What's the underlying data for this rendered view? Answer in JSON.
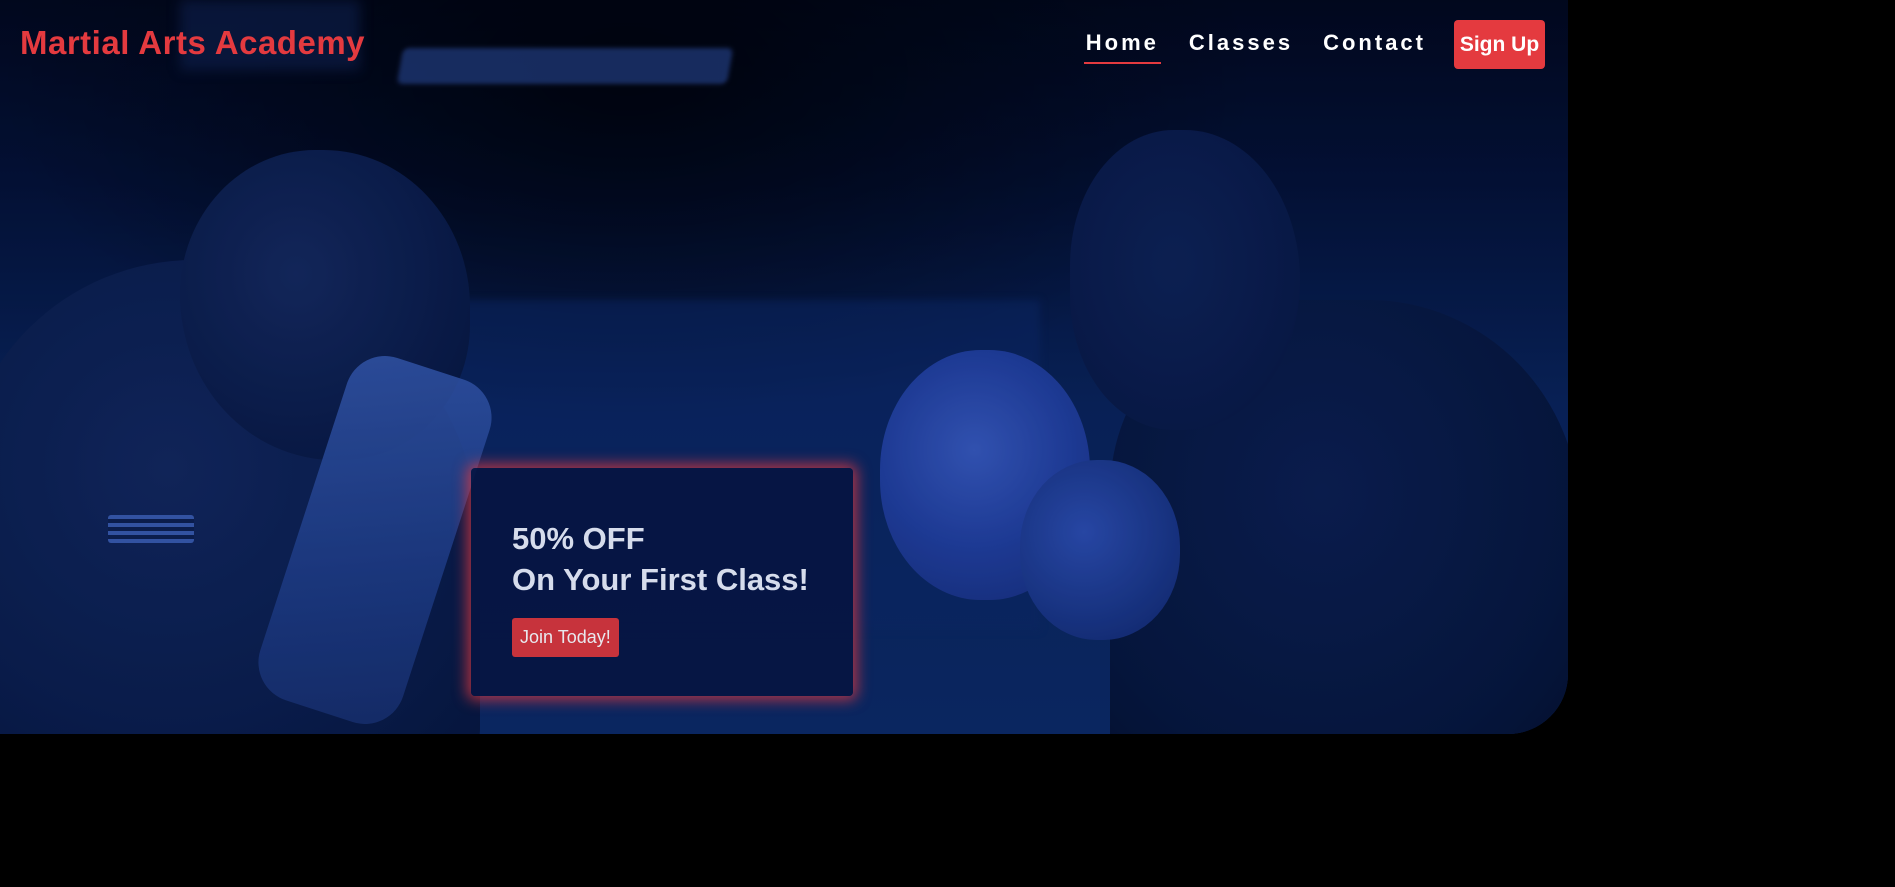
{
  "navbar": {
    "brand": "Martial Arts Academy",
    "links": [
      {
        "label": "Home",
        "active": true
      },
      {
        "label": "Classes",
        "active": false
      },
      {
        "label": "Contact",
        "active": false
      }
    ],
    "signup_label": "Sign Up"
  },
  "promo": {
    "line1": "50% OFF",
    "line2": "On Your First Class!",
    "cta_label": "Join Today!"
  },
  "colors": {
    "accent": "#e43a3f",
    "overlay": "#0a2356",
    "card_bg": "#061542"
  }
}
